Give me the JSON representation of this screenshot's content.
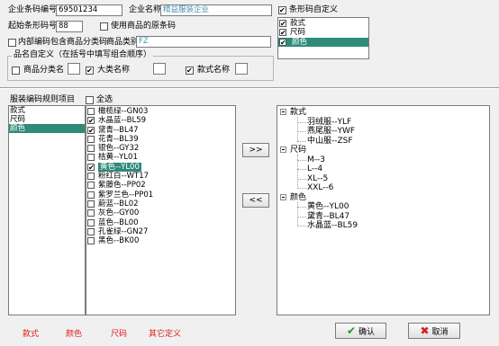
{
  "header": {
    "company_code_label": "企业条码编号",
    "company_code_value": "69501234",
    "company_name_label": "企业名称",
    "company_name_value": "精益服装企业",
    "start_barcode_label": "起始条形码号",
    "start_barcode_value": "88",
    "use_original_label": "使用商品的原条码",
    "internal_code_label": "内部编码包含商品分类码",
    "category_label": "商品类别",
    "category_value": "FZ",
    "custom_barcode_label": "条形码自定义"
  },
  "barcode_custom_list": [
    {
      "label": "款式",
      "checked": true,
      "selected": false
    },
    {
      "label": "尺码",
      "checked": true,
      "selected": false
    },
    {
      "label": "颜色",
      "checked": true,
      "selected": true
    }
  ],
  "name_group": {
    "title": "品名自定义（在括号中填写组合顺序）",
    "items": [
      {
        "label": "商品分类名",
        "checked": false,
        "value": ""
      },
      {
        "label": "大类名称",
        "checked": true,
        "value": ""
      },
      {
        "label": "款式名称",
        "checked": true,
        "value": ""
      }
    ]
  },
  "rules": {
    "title": "服装编码规则项目",
    "select_all_label": "全选",
    "items": [
      {
        "label": "款式",
        "selected": false
      },
      {
        "label": "尺码",
        "selected": false
      },
      {
        "label": "颜色",
        "selected": true
      }
    ]
  },
  "colors": [
    {
      "label": "橄榄绿--GN03",
      "checked": false,
      "selected": false
    },
    {
      "label": "水晶蓝--BL59",
      "checked": true,
      "selected": false
    },
    {
      "label": "黛青--BL47",
      "checked": true,
      "selected": false
    },
    {
      "label": "花青--BL39",
      "checked": false,
      "selected": false
    },
    {
      "label": "银色--GY32",
      "checked": false,
      "selected": false
    },
    {
      "label": "桔黄--YL01",
      "checked": false,
      "selected": false
    },
    {
      "label": "黄色--YL00",
      "checked": true,
      "selected": true
    },
    {
      "label": "粉红白--WT17",
      "checked": false,
      "selected": false
    },
    {
      "label": "紫藤色--PP02",
      "checked": false,
      "selected": false
    },
    {
      "label": "紫罗兰色--PP01",
      "checked": false,
      "selected": false
    },
    {
      "label": "蔚蓝--BL02",
      "checked": false,
      "selected": false
    },
    {
      "label": "灰色--GY00",
      "checked": false,
      "selected": false
    },
    {
      "label": "蓝色--BL00",
      "checked": false,
      "selected": false
    },
    {
      "label": "孔雀绿--GN27",
      "checked": false,
      "selected": false
    },
    {
      "label": "黑色--BK00",
      "checked": false,
      "selected": false
    }
  ],
  "arrows": {
    "add": ">>",
    "remove": "<<"
  },
  "tree": {
    "groups": [
      {
        "label": "款式",
        "children": [
          "羽绒服--YLF",
          "燕尾服--YWF",
          "中山服--ZSF"
        ]
      },
      {
        "label": "尺码",
        "children": [
          "M--3",
          "L--4",
          "XL--5",
          "XXL--6"
        ]
      },
      {
        "label": "颜色",
        "children": [
          "黄色--YL00",
          "黛青--BL47",
          "水晶蓝--BL59"
        ]
      }
    ]
  },
  "footer": {
    "tabs": [
      "款式",
      "颜色",
      "尺码",
      "其它定义"
    ],
    "confirm_label": "确认",
    "cancel_label": "取消",
    "confirm_color": "#1a9a1a",
    "cancel_color": "#d02020"
  }
}
